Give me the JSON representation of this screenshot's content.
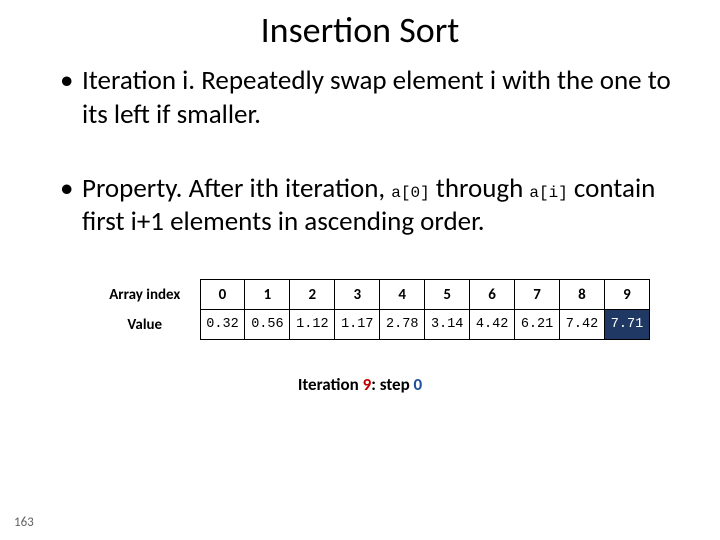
{
  "title": "Insertion Sort",
  "bullets": [
    {
      "dot": "•",
      "text_pre": "Iteration i.  Repeatedly swap element i with the one to its left if smaller.",
      "code1": "",
      "text_mid": "",
      "code2": "",
      "text_post": ""
    },
    {
      "dot": "•",
      "text_pre": "Property.  After ith iteration, ",
      "code1": "a[0]",
      "text_mid": " through ",
      "code2": "a[i]",
      "text_post": " contain first i+1 elements in ascending order."
    }
  ],
  "table": {
    "index_label": "Array index",
    "value_label": "Value",
    "indices": [
      "0",
      "1",
      "2",
      "3",
      "4",
      "5",
      "6",
      "7",
      "8",
      "9"
    ],
    "values": [
      "0.32",
      "0.56",
      "1.12",
      "1.17",
      "2.78",
      "3.14",
      "4.42",
      "6.21",
      "7.42",
      "7.71"
    ],
    "highlight_col": 9
  },
  "caption": {
    "pre": "Iteration ",
    "iteration": "9",
    "mid": ":  step ",
    "step": "0"
  },
  "page_number": "163"
}
